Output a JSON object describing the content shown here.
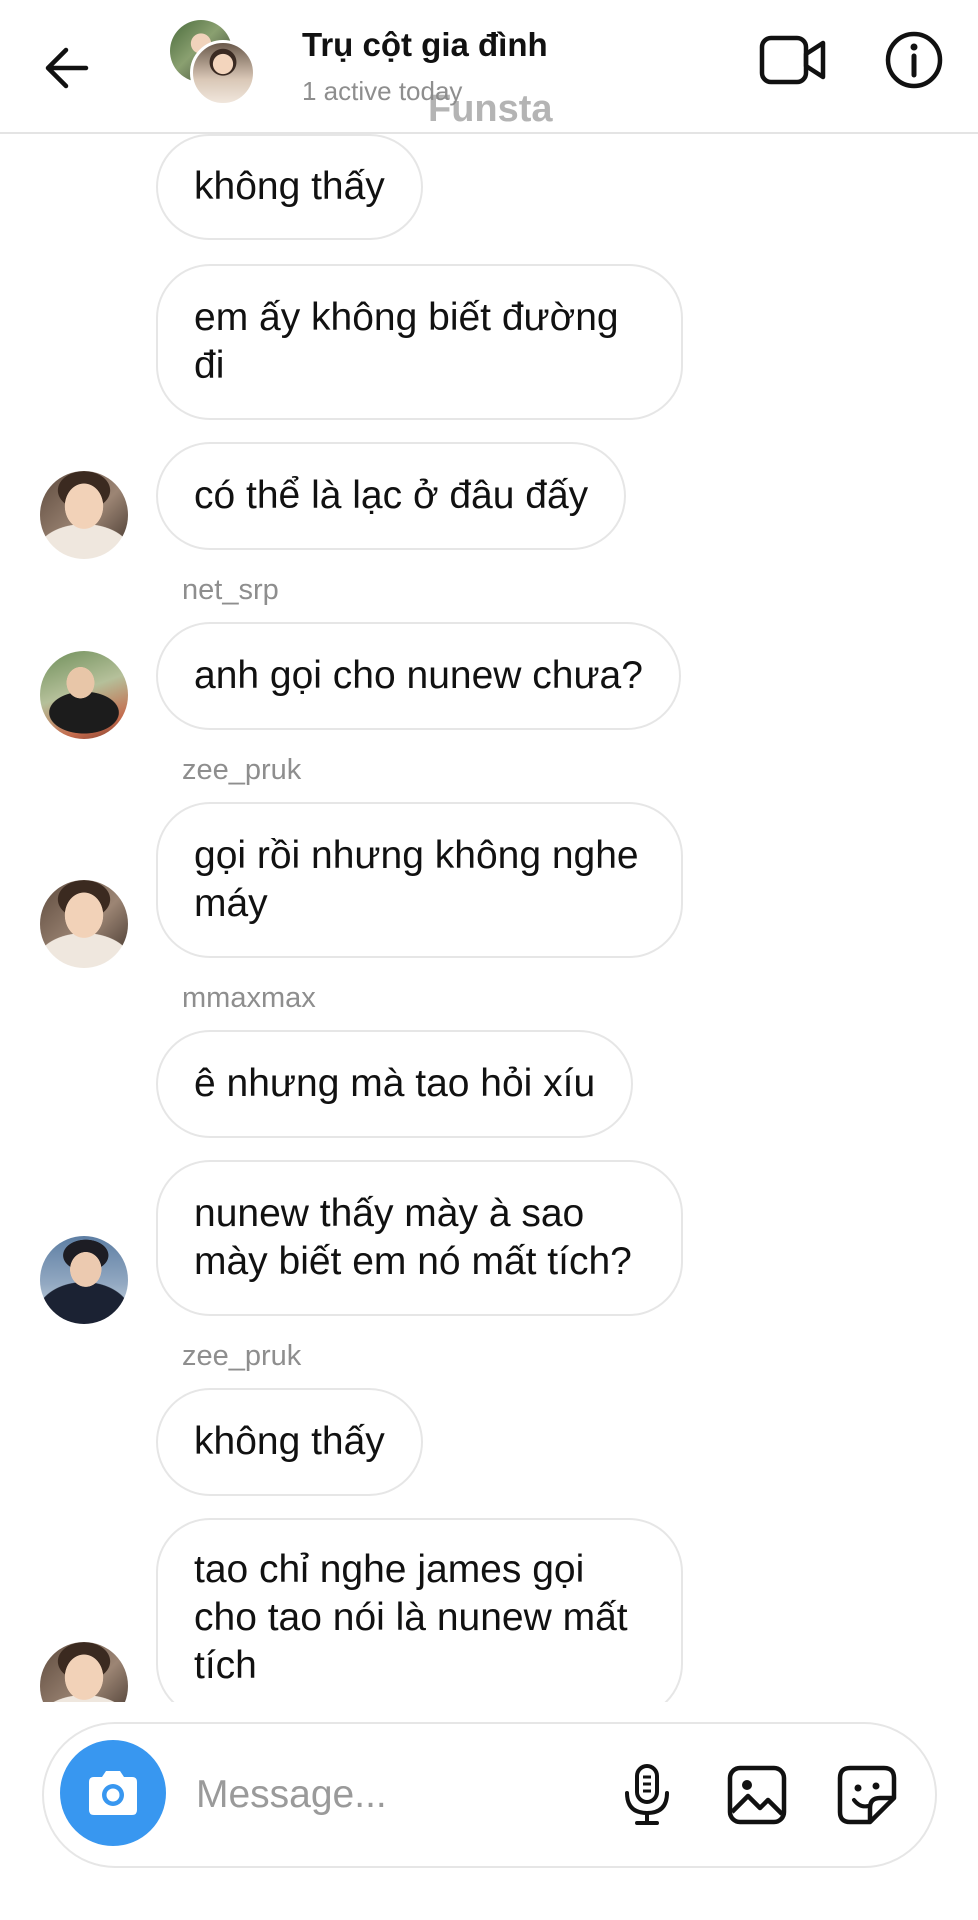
{
  "header": {
    "title": "Trụ cột gia đình",
    "subtitle": "1 active today",
    "watermark": "Funsta",
    "icons": {
      "back": "arrow-left-icon",
      "video": "video-camera-icon",
      "info": "info-circle-icon"
    }
  },
  "messages": [
    {
      "text": "không thấy"
    },
    {
      "text": "em ấy không biết đường đi"
    },
    {
      "text": "có thể là lạc ở đâu đấy"
    },
    {
      "sender": "net_srp",
      "text": "anh gọi cho nunew chưa?"
    },
    {
      "sender": "zee_pruk",
      "text": "gọi rồi nhưng không nghe máy"
    },
    {
      "sender": "mmaxmax",
      "text": "ê nhưng mà tao hỏi xíu"
    },
    {
      "text": "nunew thấy mày à sao mày biết em nó mất tích?"
    },
    {
      "sender": "zee_pruk",
      "text": "không thấy"
    },
    {
      "text": "tao chỉ nghe james gọi cho tao nói là nunew mất tích"
    }
  ],
  "composer": {
    "placeholder": "Message...",
    "accent_color": "#3897f0",
    "icons": {
      "camera": "camera-icon",
      "mic": "microphone-icon",
      "gallery": "image-icon",
      "sticker": "sticker-icon"
    }
  }
}
